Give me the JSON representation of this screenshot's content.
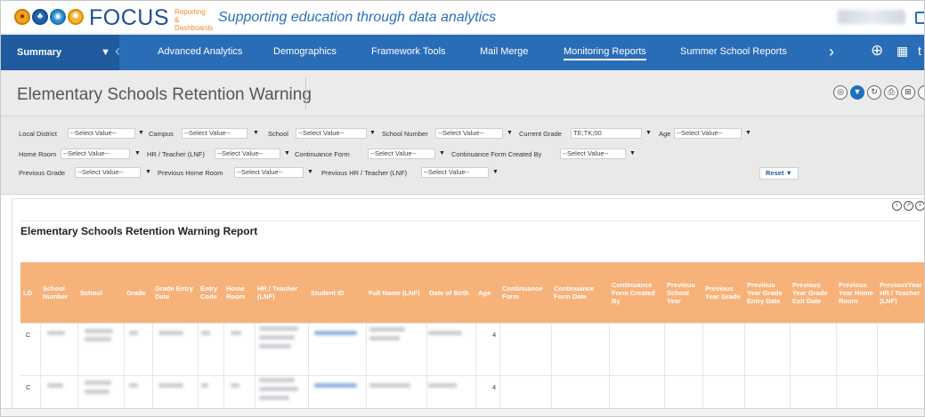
{
  "header": {
    "brand": "FOCUS",
    "brand_sub": "Reporting & Dashboards",
    "tagline": "Supporting education through data analytics"
  },
  "nav": {
    "summary_label": "Summary",
    "items": [
      {
        "label": "Advanced Analytics"
      },
      {
        "label": "Demographics"
      },
      {
        "label": "Framework Tools"
      },
      {
        "label": "Mail Merge"
      },
      {
        "label": "Monitoring Reports",
        "active": true
      },
      {
        "label": "Summer School Reports"
      }
    ],
    "icons": [
      "chevron-left-icon",
      "chevron-right-icon",
      "add-circle-icon",
      "grid-icon"
    ]
  },
  "page": {
    "title": "Elementary Schools Retention Warning"
  },
  "filters": {
    "row1": [
      {
        "label": "Local District",
        "value": "--Select Value--"
      },
      {
        "label": "Campus",
        "value": "--Select Value--"
      },
      {
        "label": "School",
        "value": "--Select Value--"
      },
      {
        "label": "School Number",
        "value": "--Select Value--"
      },
      {
        "label": "Current Grade",
        "value": "TE;TK;00"
      },
      {
        "label": "Age",
        "value": "--Select Value--"
      }
    ],
    "row2": [
      {
        "label": "Home Room",
        "value": "--Select Value--"
      },
      {
        "label": "HR / Teacher (LNF)",
        "value": "--Select Value--"
      },
      {
        "label": "Continuance Form",
        "value": "--Select Value--"
      },
      {
        "label": "Continuance Form Created By",
        "value": "--Select Value--"
      }
    ],
    "row3": [
      {
        "label": "Previous Grade",
        "value": "--Select Value--"
      },
      {
        "label": "Previous Home Room",
        "value": "--Select Value--"
      },
      {
        "label": "Previous HR / Teacher (LNF)",
        "value": "--Select Value--"
      }
    ],
    "reset_label": "Reset"
  },
  "report": {
    "title": "Elementary Schools Retention Warning Report",
    "columns": [
      "LD",
      "School Number",
      "School",
      "Grade",
      "Grade Entry Date",
      "Entry Code",
      "Home Room",
      "HR / Teacher (LNF)",
      "Student ID",
      "Full Name (LNF)",
      "Date of Birth",
      "Age",
      "Continuance Form",
      "Continuance Form Date",
      "Continuance Form Created By",
      "Previous School Year",
      "Previous Year Grade",
      "Previous Year Grade Entry Date",
      "Previous Year Grade Exit Date",
      "Previous Year Home Room",
      "PreviousYear HR / Teacher (LNF)"
    ],
    "rows": [
      {
        "ld": "C",
        "age": "4"
      },
      {
        "ld": "C",
        "age": "4"
      }
    ]
  },
  "colors": {
    "nav_bg": "#2a6db7",
    "header_row": "#f7b27a",
    "brand_blue": "#1c4f9a"
  }
}
